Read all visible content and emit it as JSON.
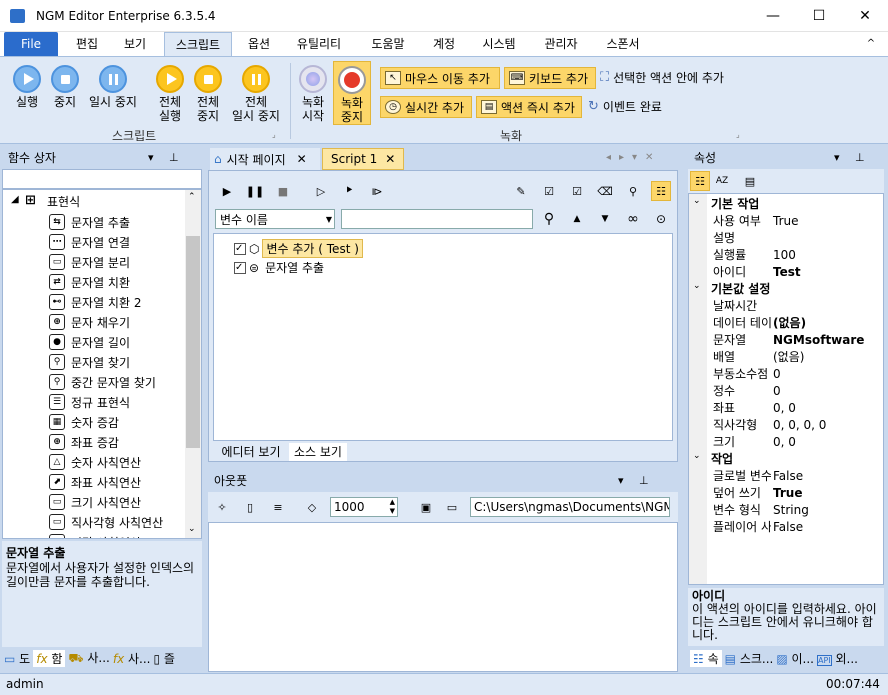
{
  "title_bar": {
    "app_name": "NGM Editor",
    "edition": "Enterprise 6.3.5.4",
    "minimize": "—",
    "maximize": "☐",
    "close": "✕"
  },
  "ribbon_tabs": [
    "File",
    "편집",
    "보기",
    "스크립트",
    "옵션",
    "유틸리티",
    "도움말",
    "계정",
    "시스템",
    "관리자",
    "스폰서"
  ],
  "ribbon_collapse": "^",
  "ribbon": {
    "run": "실행",
    "stop": "중지",
    "pause": "일시 중지",
    "run_all_1": "전체",
    "run_all_2": "실행",
    "stop_all_1": "전체",
    "stop_all_2": "중지",
    "pause_all_1": "전체",
    "pause_all_2": "일시 중지",
    "group_script": "스크립트",
    "record_start_1": "녹화",
    "record_start_2": "시작",
    "record_stop_1": "녹화",
    "record_stop_2": "중지",
    "add_mouse_move": "마우스 이동 추가",
    "add_keyboard": "키보드 추가",
    "add_inside_selected": "선택한 액션 안에 추가",
    "add_realtime": "실시간 추가",
    "add_action_immediately": "액션 즉시 추가",
    "event_complete": "이벤트 완료",
    "group_record": "녹화"
  },
  "left_panel": {
    "title": "함수 상자",
    "root": "표현식",
    "items": [
      "문자열 추출",
      "문자열 연결",
      "문자열 분리",
      "문자열 치환",
      "문자열 치환 2",
      "문자 채우기",
      "문자열 길이",
      "문자열 찾기",
      "중간 문자열 찾기",
      "정규 표현식",
      "숫자 증감",
      "좌표 증감",
      "숫자 사칙연산",
      "좌표 사칙연산",
      "크기 사칙연산",
      "직사각형 사칙연산",
      "시간 사칙연산"
    ],
    "desc_title": "문자열 추출",
    "desc_text": "문자열에서 사용자가 설정한 인덱스의 길이만큼 문자를 추출합니다.",
    "bottom_tabs": [
      "도",
      "함",
      "사...",
      "사...",
      "즐"
    ]
  },
  "doc_tabs": [
    "시작 페이지",
    "Script 1"
  ],
  "script": {
    "var_select": "변수 이름",
    "search_value": "",
    "rows": [
      "변수 추가 ( Test )",
      "문자열 추출"
    ],
    "view_tabs": [
      "에디터 보기",
      "소스 보기"
    ]
  },
  "output": {
    "title": "아웃풋",
    "count": "1000",
    "path": "C:\\Users\\ngmas\\Documents\\NGM6\\"
  },
  "properties": {
    "title": "속성",
    "categories": [
      {
        "name": "기본 작업",
        "rows": [
          {
            "k": "사용 여부",
            "v": "True",
            "b": false
          },
          {
            "k": "설명",
            "v": "",
            "b": false
          },
          {
            "k": "실행률",
            "v": "100",
            "b": false
          },
          {
            "k": "아이디",
            "v": "Test",
            "b": true
          }
        ]
      },
      {
        "name": "기본값 설정",
        "rows": [
          {
            "k": "날짜시간",
            "v": "",
            "b": false
          },
          {
            "k": "데이터 테이블",
            "v": "(없음)",
            "b": true
          },
          {
            "k": "문자열",
            "v": "NGMsoftware",
            "b": true
          },
          {
            "k": "배열",
            "v": "(없음)",
            "b": false
          },
          {
            "k": "부동소수점",
            "v": "0",
            "b": false
          },
          {
            "k": "정수",
            "v": "0",
            "b": false
          },
          {
            "k": "좌표",
            "v": "0, 0",
            "b": false
          },
          {
            "k": "직사각형",
            "v": "0, 0, 0, 0",
            "b": false
          },
          {
            "k": "크기",
            "v": "0, 0",
            "b": false
          }
        ]
      },
      {
        "name": "작업",
        "rows": [
          {
            "k": "글로벌 변수",
            "v": "False",
            "b": false
          },
          {
            "k": "덮어 쓰기",
            "v": "True",
            "b": true
          },
          {
            "k": "변수 형식",
            "v": "String",
            "b": false
          },
          {
            "k": "플레이어 사용",
            "v": "False",
            "b": false
          }
        ]
      }
    ],
    "desc_title": "아이디",
    "desc_text": "이 액션의 아이디를 입력하세요. 아이디는 스크립트 안에서 유니크해야 합니다.",
    "bottom_tabs": [
      "속",
      "스크...",
      "이...",
      "외..."
    ]
  },
  "status": {
    "user": "admin",
    "time": "00:07:44"
  }
}
